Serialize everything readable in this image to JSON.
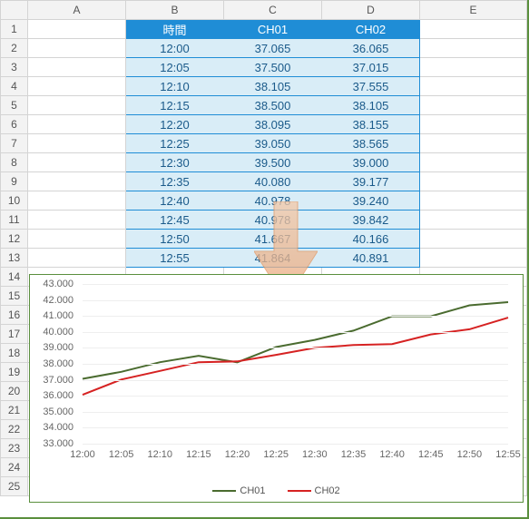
{
  "columns": [
    "A",
    "B",
    "C",
    "D",
    "E"
  ],
  "row_count": 25,
  "table": {
    "headers": [
      "時間",
      "CH01",
      "CH02"
    ],
    "rows": [
      {
        "time": "12:00",
        "ch01": "37.065",
        "ch02": "36.065"
      },
      {
        "time": "12:05",
        "ch01": "37.500",
        "ch02": "37.015"
      },
      {
        "time": "12:10",
        "ch01": "38.105",
        "ch02": "37.555"
      },
      {
        "time": "12:15",
        "ch01": "38.500",
        "ch02": "38.105"
      },
      {
        "time": "12:20",
        "ch01": "38.095",
        "ch02": "38.155"
      },
      {
        "time": "12:25",
        "ch01": "39.050",
        "ch02": "38.565"
      },
      {
        "time": "12:30",
        "ch01": "39.500",
        "ch02": "39.000"
      },
      {
        "time": "12:35",
        "ch01": "40.080",
        "ch02": "39.177"
      },
      {
        "time": "12:40",
        "ch01": "40.978",
        "ch02": "39.240"
      },
      {
        "time": "12:45",
        "ch01": "40.978",
        "ch02": "39.842"
      },
      {
        "time": "12:50",
        "ch01": "41.667",
        "ch02": "40.166"
      },
      {
        "time": "12:55",
        "ch01": "41.864",
        "ch02": "40.891"
      }
    ]
  },
  "chart_data": {
    "type": "line",
    "categories": [
      "12:00",
      "12:05",
      "12:10",
      "12:15",
      "12:20",
      "12:25",
      "12:30",
      "12:35",
      "12:40",
      "12:45",
      "12:50",
      "12:55"
    ],
    "series": [
      {
        "name": "CH01",
        "color": "#4a6b2f",
        "values": [
          37.065,
          37.5,
          38.105,
          38.5,
          38.095,
          39.05,
          39.5,
          40.08,
          40.978,
          40.978,
          41.667,
          41.864
        ]
      },
      {
        "name": "CH02",
        "color": "#d62222",
        "values": [
          36.065,
          37.015,
          37.555,
          38.105,
          38.155,
          38.565,
          39.0,
          39.177,
          39.24,
          39.842,
          40.166,
          40.891
        ]
      }
    ],
    "ylim": [
      33,
      43
    ],
    "yticks": [
      33,
      34,
      35,
      36,
      37,
      38,
      39,
      40,
      41,
      42,
      43
    ],
    "xlabel": "",
    "ylabel": "",
    "title": ""
  }
}
